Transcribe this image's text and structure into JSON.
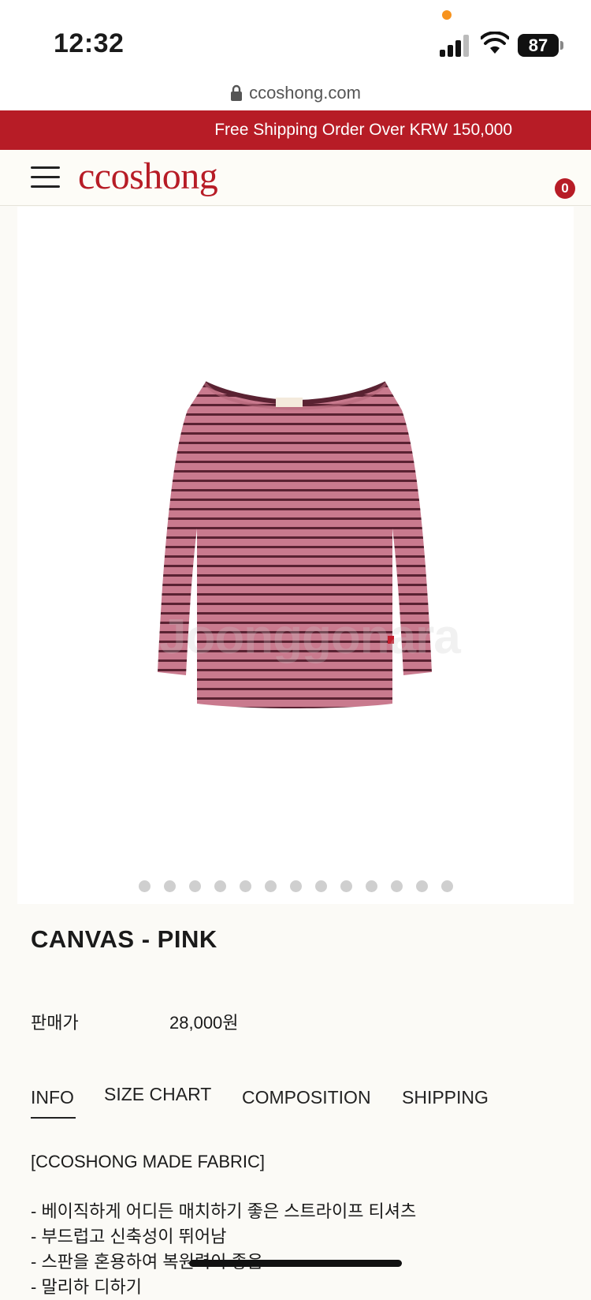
{
  "status": {
    "time": "12:32",
    "battery": "87"
  },
  "browser": {
    "url": "ccoshong.com"
  },
  "promo": {
    "text": "Free Shipping Order Over KRW 150,000"
  },
  "header": {
    "logo": "ccoshong",
    "cart_count": "0"
  },
  "gallery": {
    "slide_count": 13,
    "watermark": "Joonggonara"
  },
  "product": {
    "title": "CANVAS - PINK",
    "price_label": "판매가",
    "price": "28,000원"
  },
  "tabs": [
    {
      "label": "INFO",
      "active": true
    },
    {
      "label": "SIZE CHART",
      "active": false
    },
    {
      "label": "COMPOSITION",
      "active": false
    },
    {
      "label": "SHIPPING",
      "active": false
    }
  ],
  "info": {
    "heading": "[CCOSHONG MADE FABRIC]",
    "lines": [
      "- 베이직하게 어디든 매치하기 좋은 스트라이프 티셔츠",
      "- 부드럽고 신축성이 뛰어남",
      "- 스판을 혼용하여 복원력이 좋음",
      "- 말리하 디하기"
    ]
  },
  "colors": {
    "brand_red": "#b71c26",
    "stripe_pink": "#c97a8e",
    "stripe_dark": "#5a2232"
  }
}
